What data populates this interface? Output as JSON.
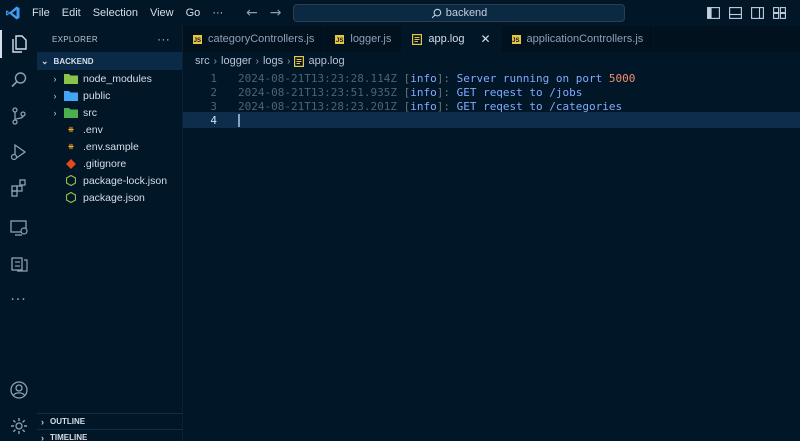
{
  "menu": [
    "File",
    "Edit",
    "Selection",
    "View",
    "Go"
  ],
  "menu_more": "···",
  "search": {
    "text": "backend"
  },
  "sidebar": {
    "title": "EXPLORER",
    "more": "···",
    "folder": "BACKEND",
    "items": [
      {
        "label": "node_modules",
        "type": "folder",
        "icon": "node-folder-icon",
        "color": "#8bc34a"
      },
      {
        "label": "public",
        "type": "folder",
        "icon": "public-folder-icon",
        "color": "#42a5f5"
      },
      {
        "label": "src",
        "type": "folder",
        "icon": "src-folder-icon",
        "color": "#4caf50"
      },
      {
        "label": ".env",
        "type": "file",
        "icon": "env-file-icon",
        "color": "#f9a825"
      },
      {
        "label": ".env.sample",
        "type": "file",
        "icon": "env-file-icon",
        "color": "#f9a825"
      },
      {
        "label": ".gitignore",
        "type": "file",
        "icon": "git-icon",
        "color": "#e64a19"
      },
      {
        "label": "package-lock.json",
        "type": "file",
        "icon": "nodejs-icon",
        "color": "#8bc34a"
      },
      {
        "label": "package.json",
        "type": "file",
        "icon": "nodejs-icon",
        "color": "#8bc34a"
      }
    ],
    "outline": "OUTLINE",
    "timeline": "TIMELINE"
  },
  "tabs": [
    {
      "label": "categoryControllers.js",
      "kind": "js",
      "active": false
    },
    {
      "label": "logger.js",
      "kind": "js",
      "active": false
    },
    {
      "label": "app.log",
      "kind": "log",
      "active": true,
      "close": "✕"
    },
    {
      "label": "applicationControllers.js",
      "kind": "js",
      "active": false
    }
  ],
  "breadcrumb": [
    "src",
    "logger",
    "logs",
    "app.log"
  ],
  "editor": {
    "lines": [
      {
        "num": "1",
        "ts": "2024-08-21T13:23:28.114Z",
        "tag_open": "[",
        "level": "info",
        "tag_close": "]:",
        "msg": " Server running on port ",
        "value": "5000"
      },
      {
        "num": "2",
        "ts": "2024-08-21T13:23:51.935Z",
        "tag_open": "[",
        "level": "info",
        "tag_close": "]:",
        "msg": " GET reqest to /jobs",
        "value": ""
      },
      {
        "num": "3",
        "ts": "2024-08-21T13:28:23.201Z",
        "tag_open": "[",
        "level": "info",
        "tag_close": "]:",
        "msg": " GET reqest to /categories",
        "value": ""
      },
      {
        "num": "4",
        "ts": "",
        "tag_open": "",
        "level": "",
        "tag_close": "",
        "msg": "",
        "value": ""
      }
    ]
  },
  "colors": {
    "background": "#011627",
    "accent": "#82aaff",
    "number": "#f78c6c",
    "timestamp": "#4b6479"
  }
}
